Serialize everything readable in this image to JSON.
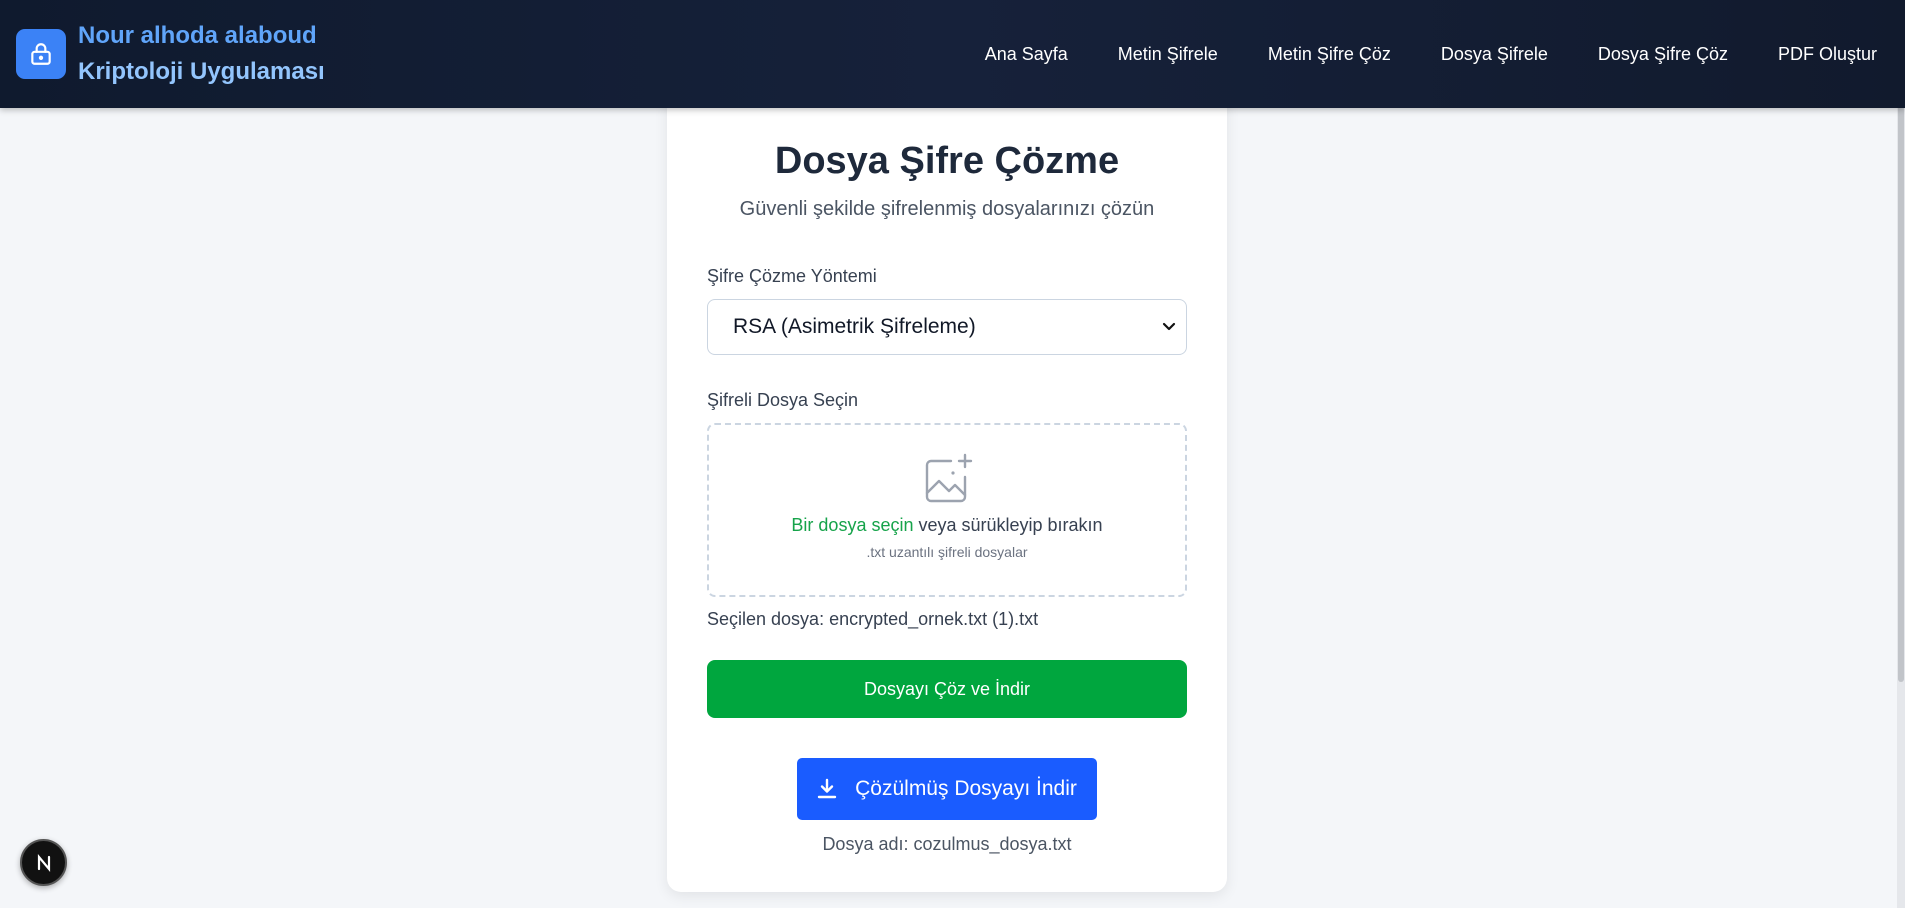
{
  "brand": {
    "line1": "Nour alhoda alaboud",
    "line2": "Kriptoloji Uygulaması",
    "icon": "lock-icon"
  },
  "nav": {
    "items": [
      "Ana Sayfa",
      "Metin Şifrele",
      "Metin Şifre Çöz",
      "Dosya Şifrele",
      "Dosya Şifre Çöz",
      "PDF Oluştur"
    ]
  },
  "page": {
    "title": "Dosya Şifre Çözme",
    "subtitle": "Güvenli şekilde şifrelenmiş dosyalarınızı çözün"
  },
  "method": {
    "label": "Şifre Çözme Yöntemi",
    "selected": "RSA (Asimetrik Şifreleme)"
  },
  "file": {
    "label": "Şifreli Dosya Seçin",
    "choose_link": "Bir dosya seçin",
    "drag_text": " veya sürükleyip bırakın",
    "hint": ".txt uzantılı şifreli dosyalar",
    "selected_prefix": "Seçilen dosya: ",
    "selected_name": "encrypted_ornek.txt (1).txt"
  },
  "actions": {
    "decrypt_label": "Dosyayı Çöz ve İndir",
    "download_label": "Çözülmüş Dosyayı İndir",
    "output_prefix": "Dosya adı: ",
    "output_name": "cozulmus_dosya.txt"
  },
  "colors": {
    "accent_blue": "#1a5cff",
    "accent_green": "#00a63e",
    "header_bg": "#0f1a2e"
  },
  "badge": {
    "letter": "N"
  }
}
